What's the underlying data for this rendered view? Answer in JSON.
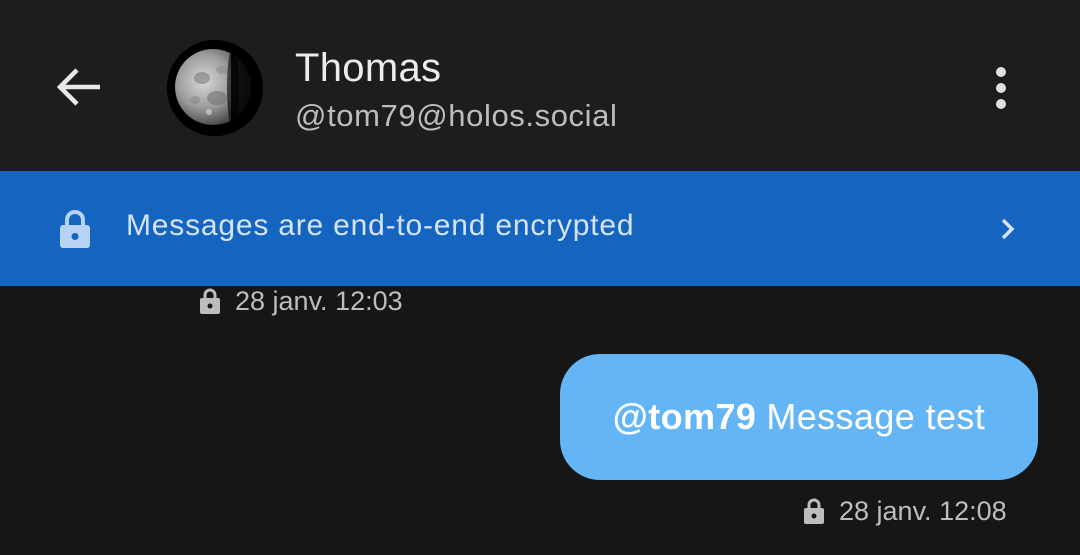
{
  "header": {
    "title": "Thomas",
    "subtitle": "@tom79@holos.social",
    "back_icon": "arrow-left-icon",
    "menu_icon": "more-vertical-icon",
    "avatar": "moon-avatar"
  },
  "banner": {
    "text": "Messages are end-to-end encrypted",
    "lock_icon": "lock-icon",
    "chevron_icon": "chevron-right-icon",
    "color": "#1565c0"
  },
  "messages": [
    {
      "timestamp": "28 janv. 12:03"
    },
    {
      "mention": "@tom79",
      "text": "Message test",
      "timestamp": "28 janv. 12:08",
      "bubble_color": "#64b5f6"
    }
  ]
}
